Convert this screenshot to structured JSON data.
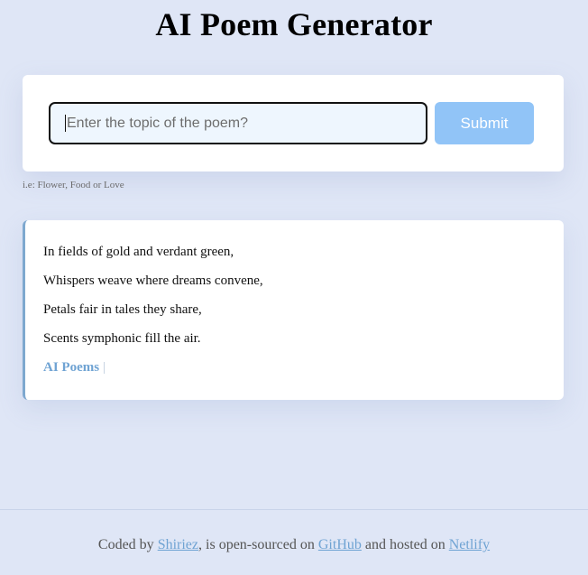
{
  "header": {
    "title": "AI Poem Generator"
  },
  "form": {
    "input_value": "",
    "input_placeholder": "Enter the topic of the poem?",
    "submit_label": "Submit",
    "hint": "i.e: Flower, Food or Love"
  },
  "poem": {
    "lines": [
      "In fields of gold and verdant green,",
      "Whispers weave where dreams convene,",
      "Petals fair in tales they share,",
      "Scents symphonic fill the air."
    ],
    "signature": "AI Poems",
    "signature_cursor": "|"
  },
  "footer": {
    "text_1": "Coded by ",
    "author_link": "Shiriez",
    "text_2": ", is open-sourced on ",
    "github_link": "GitHub",
    "text_3": " and hosted on ",
    "netlify_link": "Netlify"
  },
  "colors": {
    "background": "#dfe6f6",
    "submit_button": "#91c4f7",
    "accent": "#6fa3d3"
  }
}
